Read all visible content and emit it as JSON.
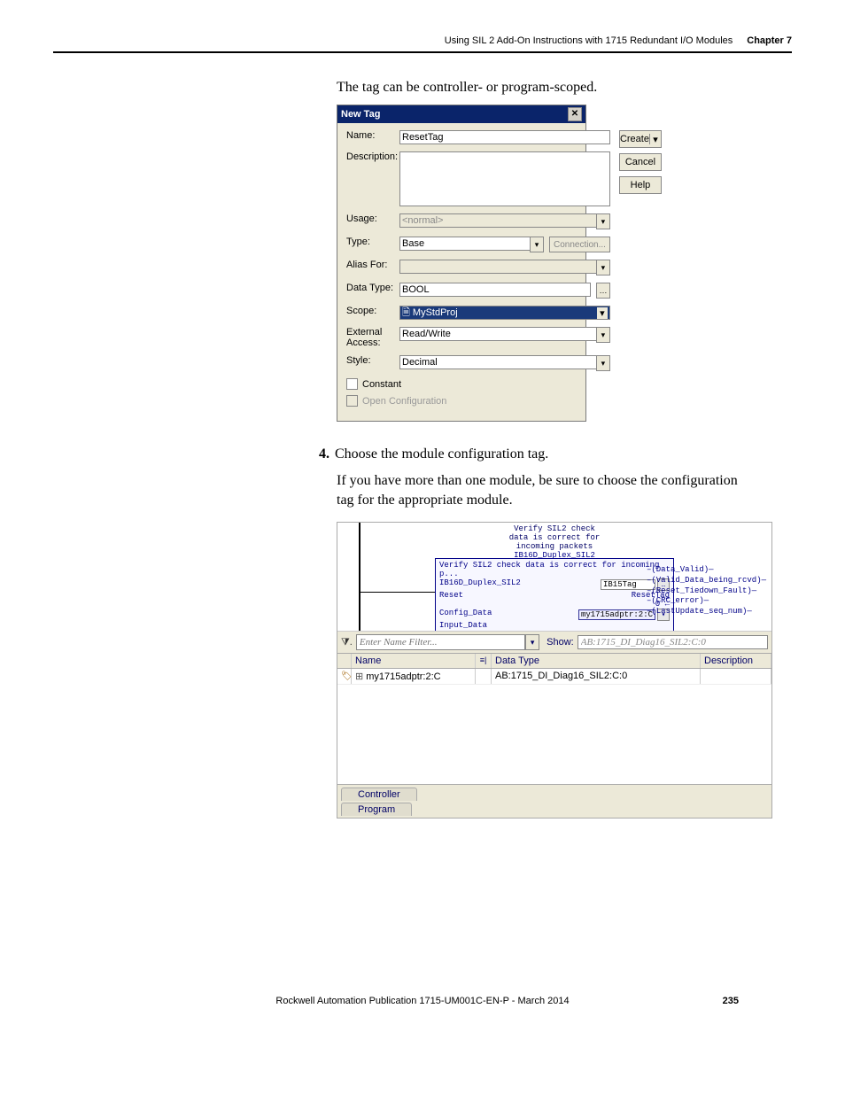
{
  "header": {
    "chapter_title": "Using SIL 2 Add-On Instructions with 1715 Redundant I/O Modules",
    "chapter_label": "Chapter 7"
  },
  "intro_text": "The tag can be controller- or program-scoped.",
  "newtag": {
    "title": "New Tag",
    "close": "✕",
    "labels": {
      "name": "Name:",
      "description": "Description:",
      "usage": "Usage:",
      "type": "Type:",
      "alias": "Alias For:",
      "datatype": "Data Type:",
      "scope": "Scope:",
      "external": "External Access:",
      "style": "Style:",
      "constant": "Constant",
      "openconfig": "Open Configuration",
      "connection": "Connection..."
    },
    "values": {
      "name": "ResetTag",
      "usage": "<normal>",
      "type": "Base",
      "datatype": "BOOL",
      "scope": "🗎 MyStdProj",
      "external": "Read/Write",
      "style": "Decimal",
      "datatype_btn": "…"
    },
    "buttons": {
      "create": "Create",
      "create_drop": "▾",
      "cancel": "Cancel",
      "help": "Help"
    }
  },
  "step4": {
    "num": "4.",
    "text": "Choose the module configuration tag.",
    "sub": "If you have more than one module, be sure to choose the configuration tag for the appropriate module."
  },
  "ladder": {
    "rung_desc_l1": "Verify SIL2 check",
    "rung_desc_l2": "data is correct for",
    "rung_desc_l3": "incoming packets",
    "aoi_title": "IB16D_Duplex_SIL2",
    "aoi_caption": "Verify SIL2 check data is correct for incoming p...",
    "rows": {
      "inst_lbl": "IB16D_Duplex_SIL2",
      "inst_val": "IB15Tag",
      "reset_lbl": "Reset",
      "reset_val": "ResetTag",
      "reset_state": "0 ←",
      "cfg_lbl": "Config_Data",
      "cfg_val": "my1715adptr:2:C",
      "in_lbl": "Input_Data"
    },
    "outputs": [
      "–(Data_Valid)—",
      "–(Valid_Data_being_rcvd)—",
      "–(Reset_Tiedown_Fault)—",
      "–(CRC_error)—",
      "–(LastUpdate_seq_num)—"
    ],
    "filter": {
      "placeholder": "Enter Name Filter...",
      "show_label": "Show:",
      "show_value": "AB:1715_DI_Diag16_SIL2:C:0"
    },
    "grid": {
      "col_name": "Name",
      "col_dt": "Data Type",
      "col_desc": "Description",
      "row_name": "my1715adptr:2:C",
      "row_dt": "AB:1715_DI_Diag16_SIL2:C:0"
    },
    "tabs": {
      "controller": "Controller",
      "program": "Program"
    }
  },
  "footer": {
    "pub": "Rockwell Automation Publication 1715-UM001C-EN-P - March 2014",
    "page": "235"
  }
}
